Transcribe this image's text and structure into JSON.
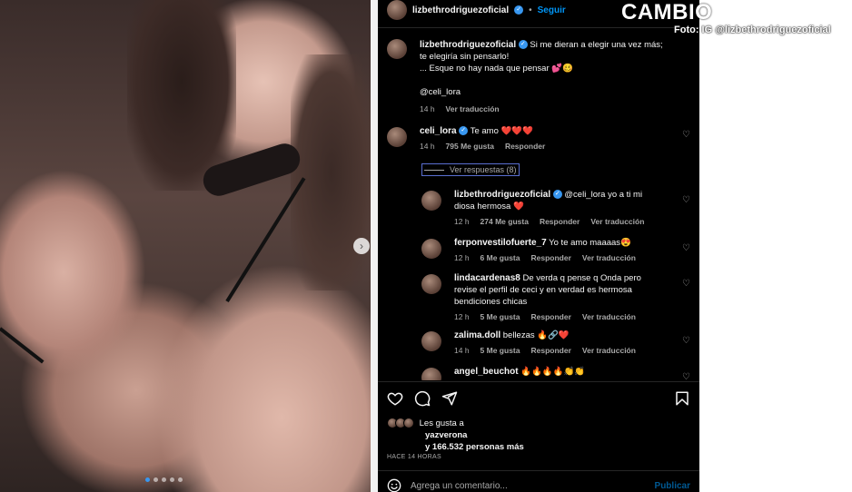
{
  "post": {
    "username": "lizbethrodriguezoficial",
    "follow_label": "Seguir",
    "caption_lines": [
      "Si me dieran a elegir una vez más;",
      "te elegiría sin pensarlo!",
      "... Esque no hay nada que pensar 💕🥴",
      "",
      "@celi_lora"
    ],
    "caption_time": "14 h",
    "caption_translate": "Ver traducción"
  },
  "comments": [
    {
      "user": "celi_lora",
      "verified": true,
      "text": "Te amo ❤️❤️❤️",
      "time": "14 h",
      "likes": "795 Me gusta",
      "reply": "Responder"
    }
  ],
  "view_replies": "Ver respuestas (8)",
  "replies": [
    {
      "user": "lizbethrodriguezoficial",
      "verified": true,
      "text_lines": [
        "@celi_lora yo a ti mi",
        "diosa hermosa ❤️"
      ],
      "time": "12 h",
      "likes": "274 Me gusta",
      "reply": "Responder",
      "translate": "Ver traducción"
    },
    {
      "user": "ferponvestilofuerte_7",
      "verified": false,
      "text_lines": [
        "Yo te amo maaaas😍"
      ],
      "time": "12 h",
      "likes": "6 Me gusta",
      "reply": "Responder",
      "translate": "Ver traducción"
    },
    {
      "user": "lindacardenas8",
      "verified": false,
      "text_lines": [
        "De verda q pense q Onda pero",
        "revise el perfil de ceci y en verdad es hermosa",
        "bendiciones chicas"
      ],
      "time": "12 h",
      "likes": "5 Me gusta",
      "reply": "Responder",
      "translate": "Ver traducción"
    },
    {
      "user": "zalima.doll",
      "verified": false,
      "text_lines": [
        "bellezas 🔥🔗❤️"
      ],
      "time": "14 h",
      "likes": "5 Me gusta",
      "reply": "Responder",
      "translate": "Ver traducción"
    },
    {
      "user": "angel_beuchot",
      "verified": false,
      "text_lines": [
        "🔥🔥🔥🔥👏👏"
      ],
      "time": "",
      "likes": "",
      "reply": "",
      "translate": ""
    }
  ],
  "likes": {
    "line1": "Les gusta a",
    "name": "yazverona",
    "line3": "y 166.532 personas más"
  },
  "time_ago": "HACE 14 HORAS",
  "add_comment": {
    "placeholder": "Agrega un comentario...",
    "publish": "Publicar"
  },
  "brand": {
    "logo": "CAMBIO",
    "credit": "Foto: IG @lizbethrodriguezoficial"
  },
  "icons": [
    "heart-icon",
    "comment-icon",
    "share-icon",
    "bookmark-icon",
    "emoji-icon",
    "chevron-right-icon",
    "verified-icon"
  ],
  "colors": {
    "ig_bg": "#000000",
    "link_blue": "#0095f6",
    "verified_blue": "#3897f0",
    "muted": "#a8a8a8"
  }
}
